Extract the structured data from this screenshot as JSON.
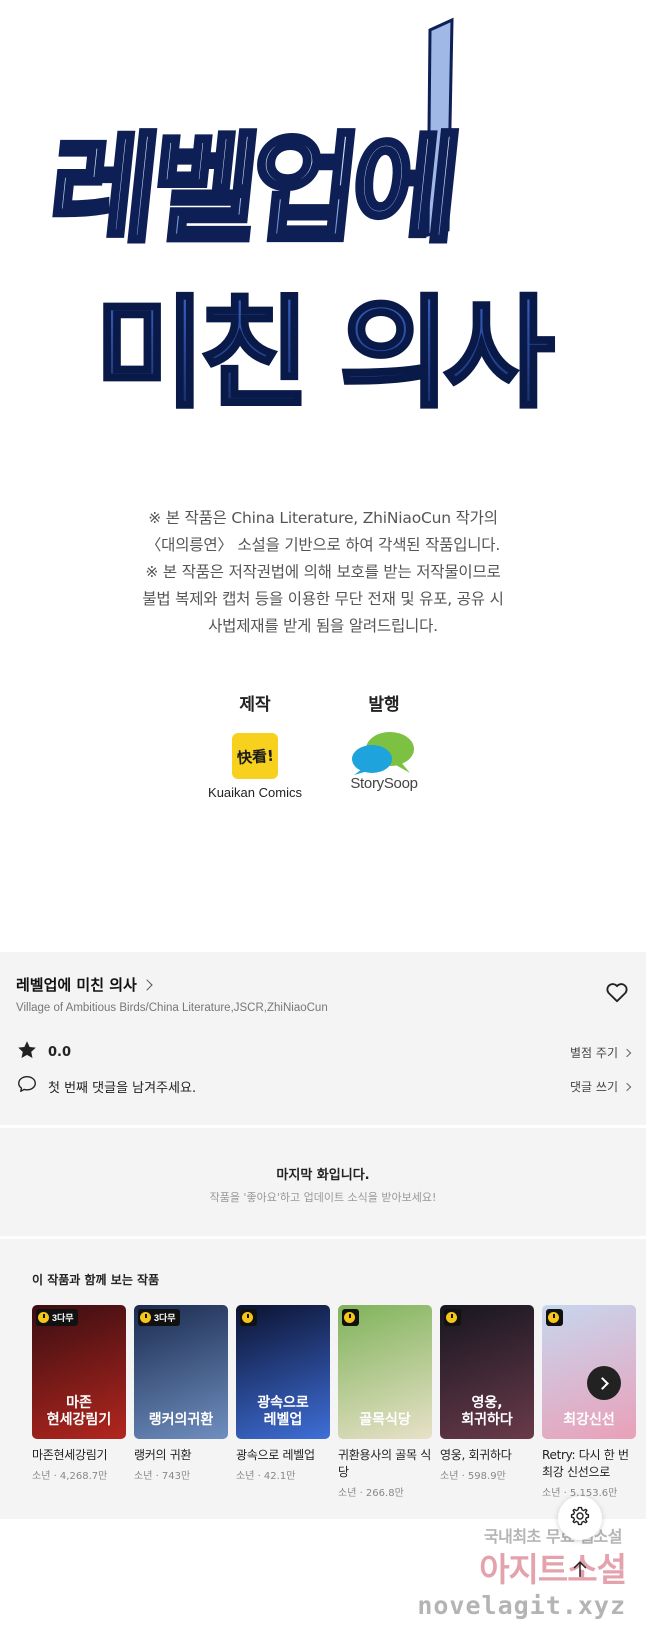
{
  "hero": {
    "title_line1": "레벨업에",
    "title_line2": "미친 의사",
    "colors": {
      "text_fill": "#1f3c8f",
      "text_light": "#dbe9ff",
      "outline": "#0e1f55"
    }
  },
  "notice": {
    "lines": [
      "※ 본 작품은 China Literature, ZhiNiaoCun 작가의",
      "〈대의릉연〉 소설을 기반으로 하여 각색된 작품입니다.",
      "※ 본 작품은 저작권법에 의해 보호를 받는 저작물이므로",
      "불법 복제와 캡처 등을 이용한 무단 전재 및 유포, 공유 시",
      "사법제재를 받게 됨을 알려드립니다."
    ]
  },
  "credits": {
    "production_label": "제작",
    "production_logo_text": "快看!",
    "production_name": "Kuaikan Comics",
    "publisher_label": "발행",
    "publisher_name": "StorySoop"
  },
  "info": {
    "title": "레벨업에 미친 의사",
    "authors": "Village of Ambitious Birds/China Literature,JSCR,ZhiNiaoCun",
    "rating": "0.0",
    "rate_action": "별점 주기",
    "comment_prompt": "첫 번째 댓글을 남겨주세요.",
    "comment_action": "댓글 쓰기"
  },
  "last_episode": {
    "title": "마지막 화입니다.",
    "subtitle": "작품을 '좋아요'하고 업데이트 소식을 받아보세요!"
  },
  "recommendations": {
    "heading": "이 작품과 함께 보는 작품",
    "items": [
      {
        "title": "마존현세강림기",
        "meta": "소년 · 4,268.7만",
        "badge": "3다무",
        "cover_text": "마존\n현세강림기",
        "color1": "#3a0e12",
        "color2": "#b3261e"
      },
      {
        "title": "랭커의 귀환",
        "meta": "소년 · 743만",
        "badge": "3다무",
        "cover_text": "랭커의귀환",
        "color1": "#1b2b4f",
        "color2": "#6f8fc0"
      },
      {
        "title": "광속으로 레벨업",
        "meta": "소년 · 42.1만",
        "badge": "",
        "cover_text": "광속으로\n레벨업",
        "color1": "#0b1230",
        "color2": "#3f6fd8"
      },
      {
        "title": "귀환용사의 골목 식당",
        "meta": "소년 · 266.8만",
        "badge": "",
        "cover_text": "골목식당",
        "color1": "#7fb35a",
        "color2": "#e8e1c8"
      },
      {
        "title": "영웅, 회귀하다",
        "meta": "소년 · 598.9만",
        "badge": "",
        "cover_text": "영웅,\n회귀하다",
        "color1": "#161620",
        "color2": "#6a3a4a"
      },
      {
        "title": "Retry: 다시 한 번 최강 신선으로",
        "meta": "소년 · 5,153.6만",
        "badge": "",
        "cover_text": "최강신선",
        "color1": "#c7d6ef",
        "color2": "#e9a0b8"
      }
    ]
  },
  "watermark": {
    "line1": "국내최초 무료 웹소설",
    "line2": "아지트소설",
    "line3": "novelagit.xyz"
  },
  "icons": {
    "heart": "heart-icon",
    "star": "star-icon",
    "comment": "comment-icon",
    "next": "chevron-right-icon",
    "settings": "gear-icon",
    "top": "arrow-up-icon"
  }
}
